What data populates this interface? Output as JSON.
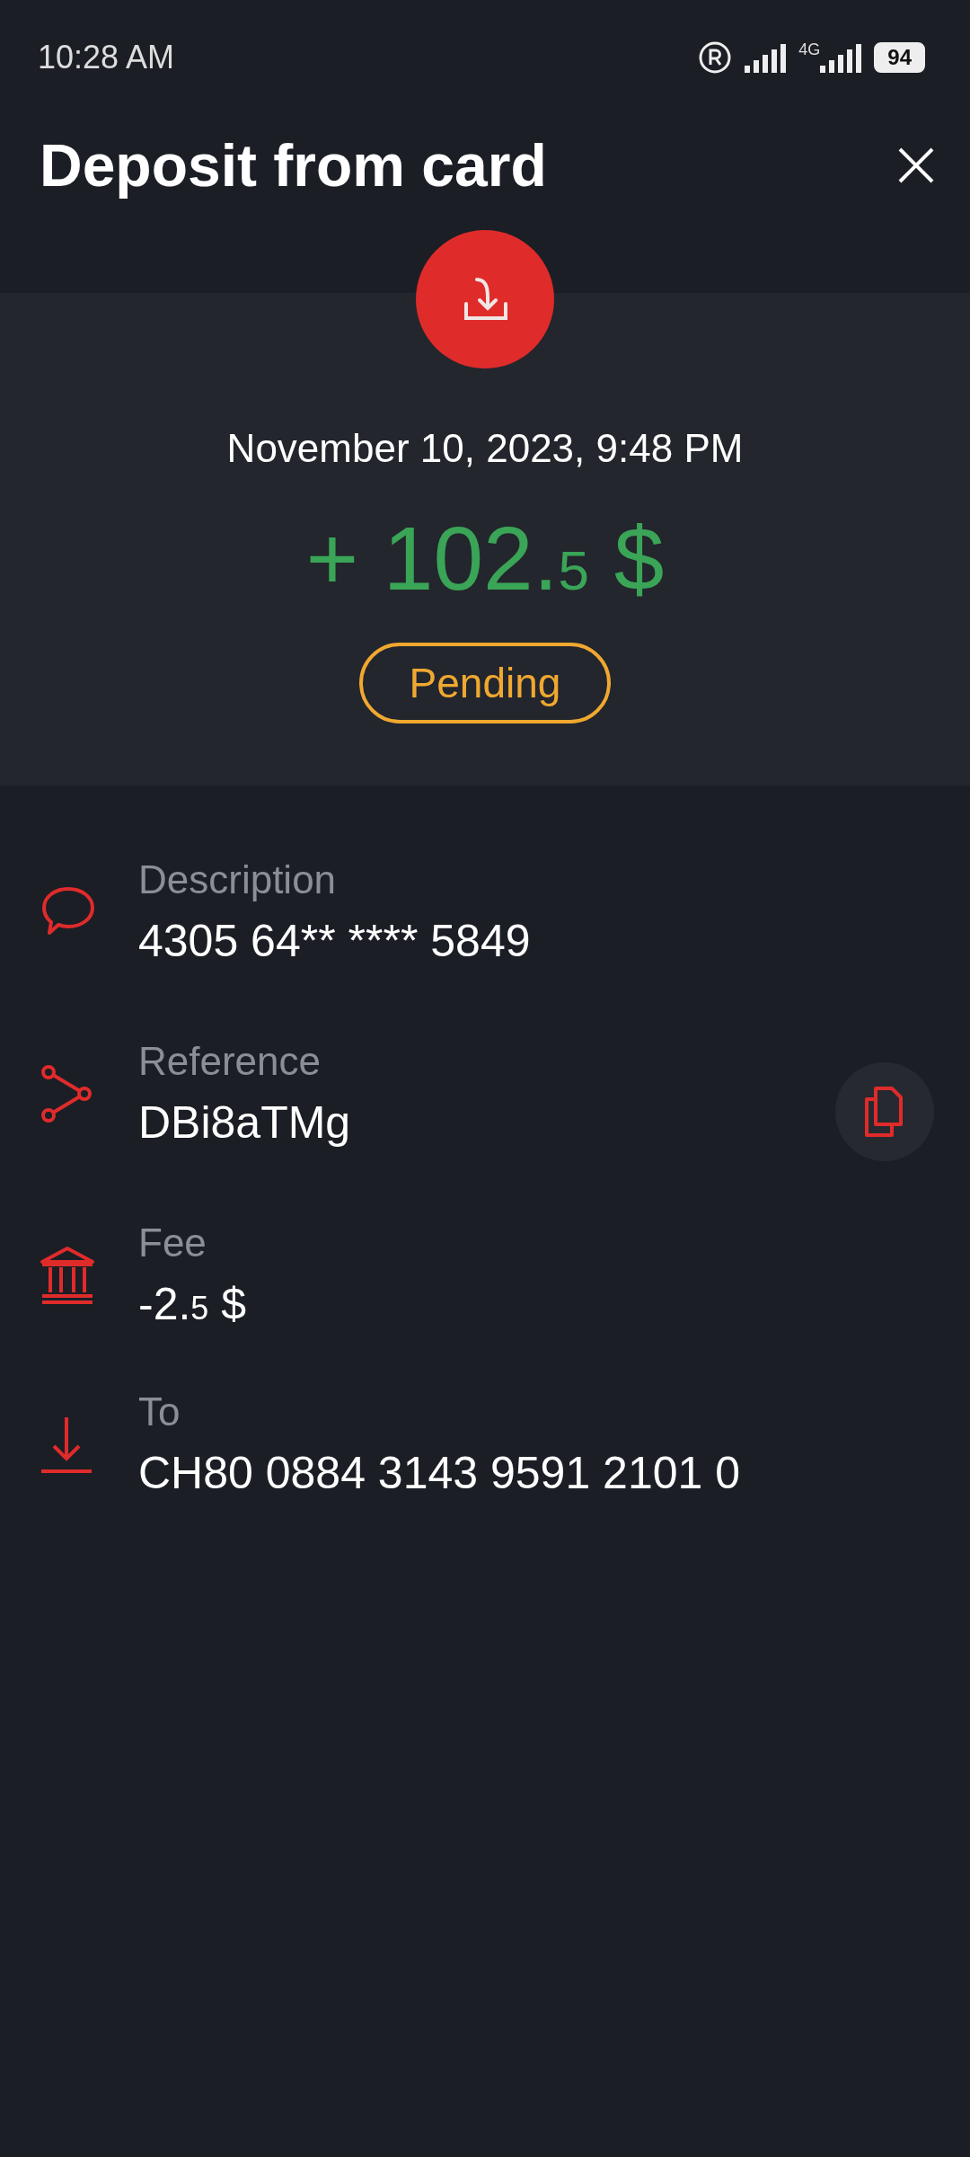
{
  "status_bar": {
    "time": "10:28 AM",
    "network": "4G",
    "battery": "94"
  },
  "header": {
    "title": "Deposit from card"
  },
  "transaction": {
    "date": "November 10, 2023, 9:48 PM",
    "amount_main": "+ 102.",
    "amount_fraction": "5",
    "currency": "$",
    "status": "Pending"
  },
  "details": [
    {
      "kind": "comment",
      "label": "Description",
      "value": "4305 64** **** 5849",
      "copyable": false
    },
    {
      "kind": "share",
      "label": "Reference",
      "value": "DBi8aTMg",
      "copyable": true
    },
    {
      "kind": "bank",
      "label": "Fee",
      "value": "-2.",
      "value_fraction": "5",
      "currency": "$",
      "copyable": false
    },
    {
      "kind": "download",
      "label": "To",
      "value": "CH80 0884 3143 9591 2101 0",
      "copyable": false
    }
  ]
}
